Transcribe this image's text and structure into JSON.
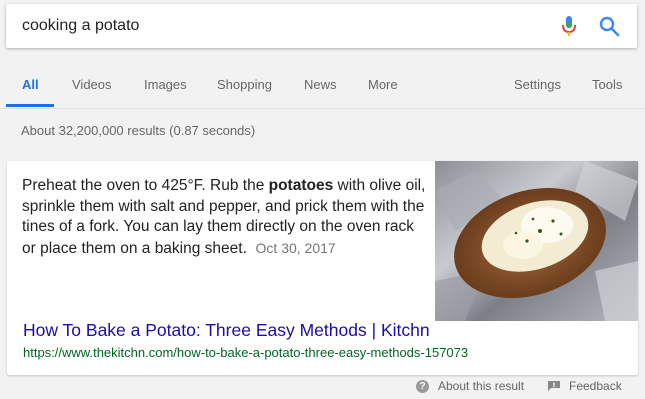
{
  "search": {
    "query": "cooking a potato"
  },
  "nav": {
    "tabs": [
      "All",
      "Videos",
      "Images",
      "Shopping",
      "News",
      "More"
    ],
    "settings": "Settings",
    "tools": "Tools"
  },
  "stats": "About 32,200,000 results (0.87 seconds)",
  "featured": {
    "snippet_before": "Preheat the oven to 425°F. Rub the ",
    "snippet_bold": "potatoes",
    "snippet_after": " with olive oil, sprinkle them with salt and pepper, and prick them with the tines of a fork. You can lay them directly on the oven rack or place them on a baking sheet.",
    "date": "Oct 30, 2017",
    "title": "How To Bake a Potato: Three Easy Methods | Kitchn",
    "url": "https://www.thekitchn.com/how-to-bake-a-potato-three-easy-methods-157073"
  },
  "footer": {
    "about": "About this result",
    "feedback": "Feedback"
  },
  "colors": {
    "link": "#1a0dab",
    "url": "#006621",
    "accent": "#1a73e8"
  }
}
